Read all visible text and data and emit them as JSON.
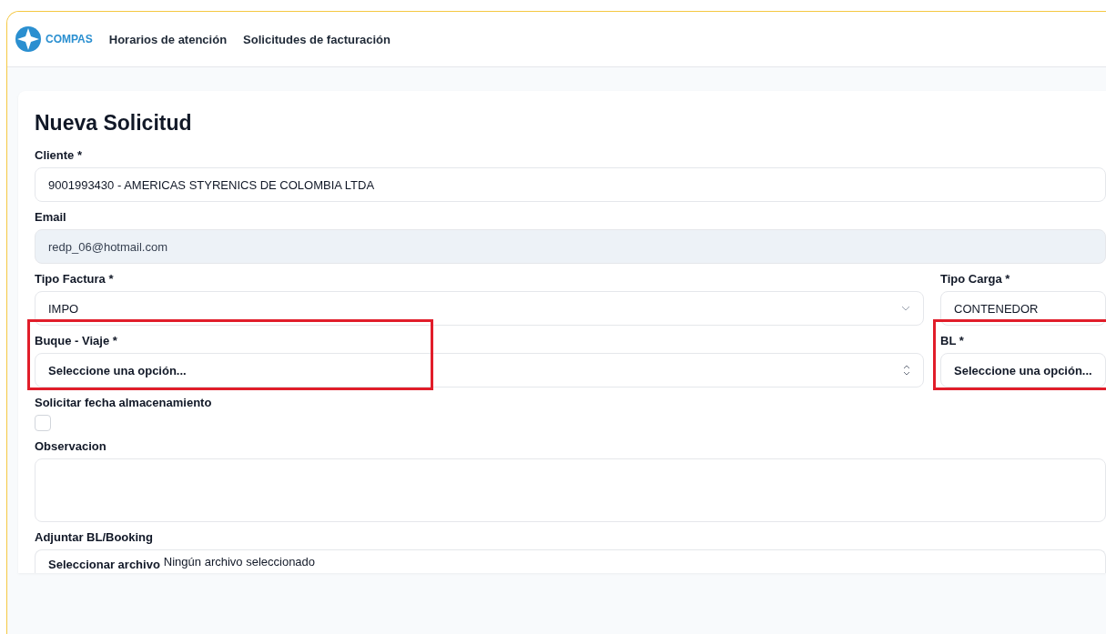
{
  "nav": {
    "brand": "COMPAS",
    "links": [
      "Horarios de atención",
      "Solicitudes de facturación"
    ]
  },
  "form": {
    "title": "Nueva Solicitud",
    "rows": [
      {
        "fields": [
          {
            "label": "Cliente *",
            "kind": "text",
            "value": "9001993430 - AMERICAS STYRENICS DE COLOMBIA LTDA"
          }
        ]
      },
      {
        "fields": [
          {
            "label": "Email",
            "kind": "text",
            "value": "redp_06@hotmail.com",
            "disabled": true
          }
        ]
      },
      {
        "fields": [
          {
            "label": "Tipo Factura *",
            "kind": "select",
            "value": "IMPO"
          },
          {
            "label": "Tipo Carga *",
            "kind": "text",
            "value": "CONTENEDOR"
          }
        ]
      },
      {
        "fields": [
          {
            "label": "Buque - Viaje *",
            "kind": "combobox",
            "value": "Seleccione una opción...",
            "highlighted": true
          },
          {
            "label": "BL *",
            "kind": "combobox",
            "value": "Seleccione una opción...",
            "highlighted": true
          }
        ]
      },
      {
        "fields": [
          {
            "label": "Solicitar fecha almacenamiento",
            "kind": "checkbox",
            "checked": false
          }
        ]
      },
      {
        "fields": [
          {
            "label": "Observacion",
            "kind": "textarea"
          }
        ]
      },
      {
        "fields": [
          {
            "label": "Adjuntar BL/Booking",
            "kind": "file",
            "button": "Seleccionar archivo",
            "status": "Ningún archivo seleccionado"
          }
        ]
      }
    ]
  }
}
